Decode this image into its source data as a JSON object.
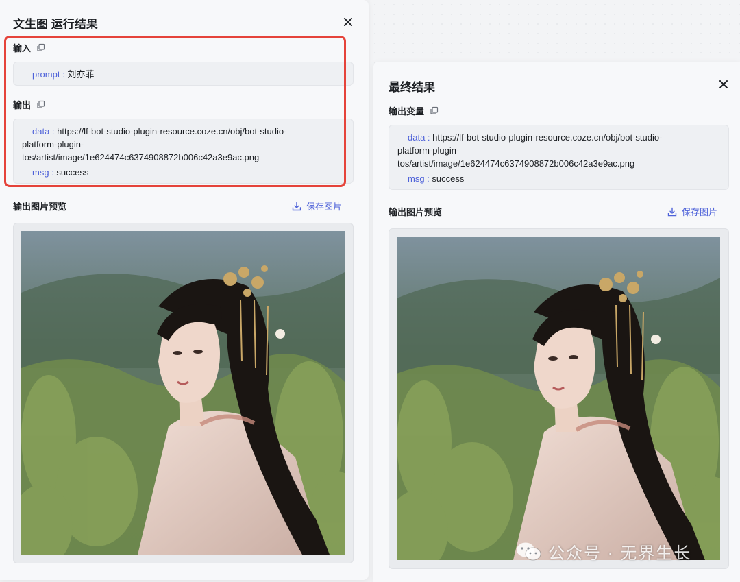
{
  "left_panel": {
    "title": "文生图 运行结果",
    "input_label": "输入",
    "input": {
      "key": "prompt",
      "sep": " : ",
      "value": "刘亦菲"
    },
    "output_label": "输出",
    "output": {
      "data_key": "data",
      "data_line1": "https://lf-bot-studio-plugin-resource.coze.cn/obj/bot-studio-",
      "data_line2": "platform-plugin-",
      "data_line3": "tos/artist/image/1e624474c6374908872b006c42a3e9ac.png",
      "msg_key": "msg",
      "msg_value": "success",
      "sep": " : "
    },
    "preview_label": "输出图片预览",
    "save_label": "保存图片"
  },
  "right_panel": {
    "title": "最终结果",
    "output_var_label": "输出变量",
    "output": {
      "data_key": "data",
      "data_line1": "https://lf-bot-studio-plugin-resource.coze.cn/obj/bot-studio-",
      "data_line2": "platform-plugin-",
      "data_line3": "tos/artist/image/1e624474c6374908872b006c42a3e9ac.png",
      "msg_key": "msg",
      "msg_value": "success",
      "sep": " : "
    },
    "preview_label": "输出图片预览",
    "save_label": "保存图片"
  },
  "watermark": {
    "text": "公众号 · 无界生长"
  },
  "icons": {
    "close": "close-icon",
    "copy": "copy-icon",
    "download": "download-icon",
    "wechat": "wechat-icon"
  },
  "colors": {
    "accent": "#4e62d9",
    "highlight": "#e5433a",
    "panel_bg": "#f7f8fa",
    "box_bg": "#eef0f3"
  }
}
